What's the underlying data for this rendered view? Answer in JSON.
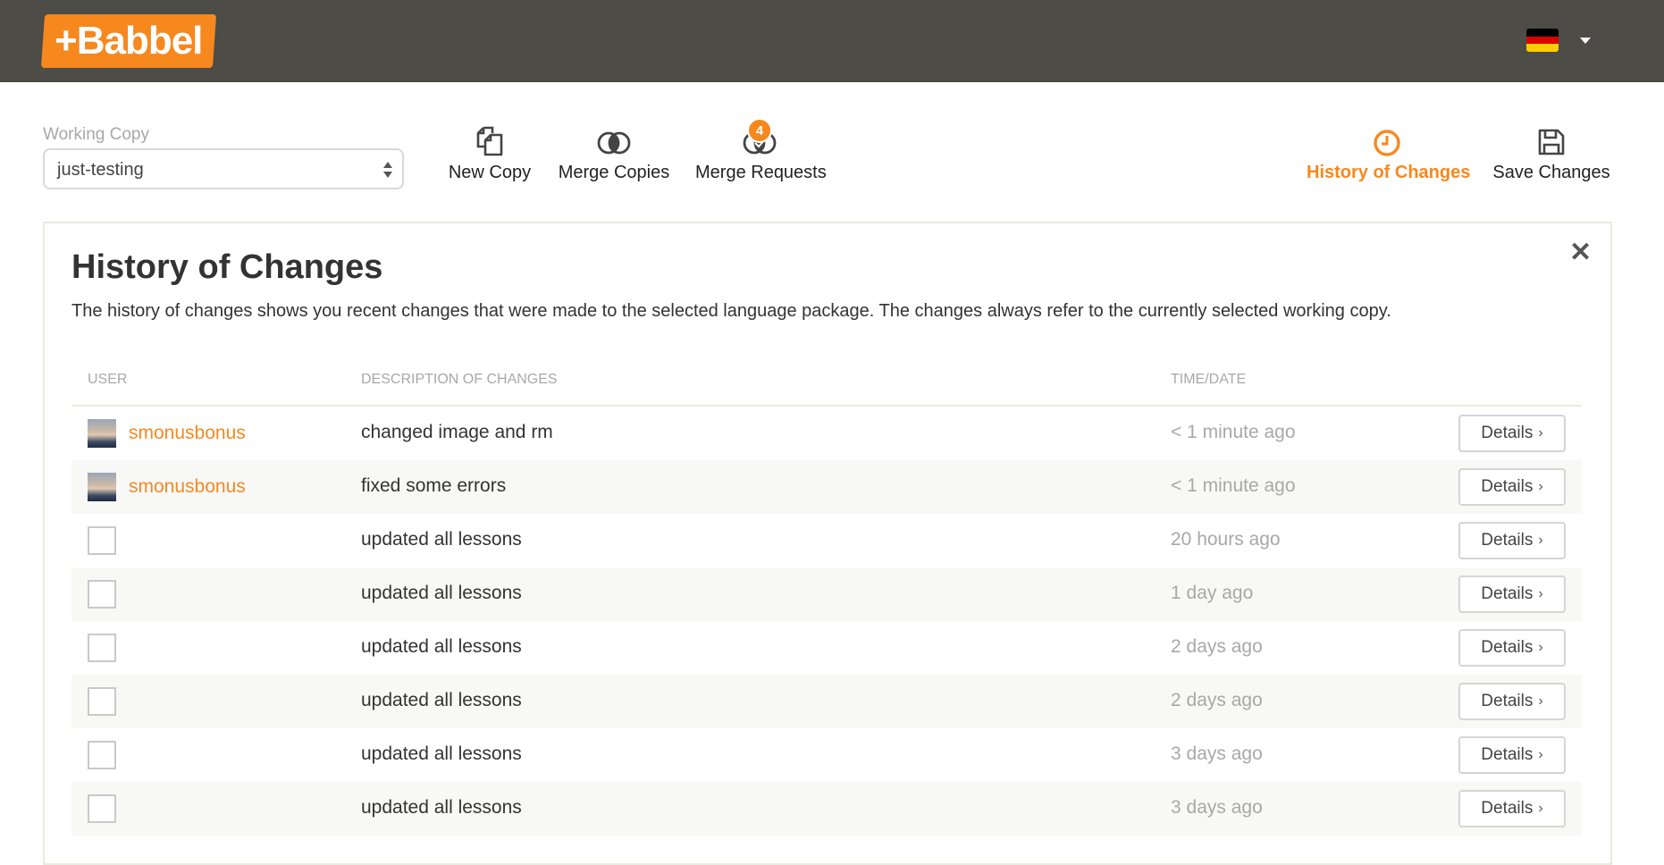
{
  "header": {
    "logo_text": "+Babbel",
    "brand_color": "#f7881e",
    "bar_color": "#4d4c46",
    "language_flag": "germany-flag-icon"
  },
  "toolbar": {
    "working_copy_label": "Working Copy",
    "working_copy_value": "just-testing",
    "new_copy": "New Copy",
    "merge_copies": "Merge Copies",
    "merge_requests": "Merge Requests",
    "merge_requests_badge": "4",
    "history_of_changes": "History of Changes",
    "save_changes": "Save Changes"
  },
  "panel": {
    "title": "History of Changes",
    "description": "The history of changes shows you recent changes that were made to the selected language package. The changes always refer to the currently selected working copy.",
    "columns": {
      "user": "User",
      "description": "Description of changes",
      "time": "Time/Date"
    },
    "rows": [
      {
        "user": "smonusbonus",
        "description": "changed image and rm",
        "time": "< 1 minute ago",
        "action": "Details"
      },
      {
        "user": "smonusbonus",
        "description": "fixed some errors",
        "time": "< 1 minute ago",
        "action": "Details"
      },
      {
        "user": "",
        "description": "updated all lessons",
        "time": "20 hours ago",
        "action": "Details"
      },
      {
        "user": "",
        "description": "updated all lessons",
        "time": "1 day ago",
        "action": "Details"
      },
      {
        "user": "",
        "description": "updated all lessons",
        "time": "2 days ago",
        "action": "Details"
      },
      {
        "user": "",
        "description": "updated all lessons",
        "time": "2 days ago",
        "action": "Details"
      },
      {
        "user": "",
        "description": "updated all lessons",
        "time": "3 days ago",
        "action": "Details"
      },
      {
        "user": "",
        "description": "updated all lessons",
        "time": "3 days ago",
        "action": "Details"
      }
    ]
  }
}
